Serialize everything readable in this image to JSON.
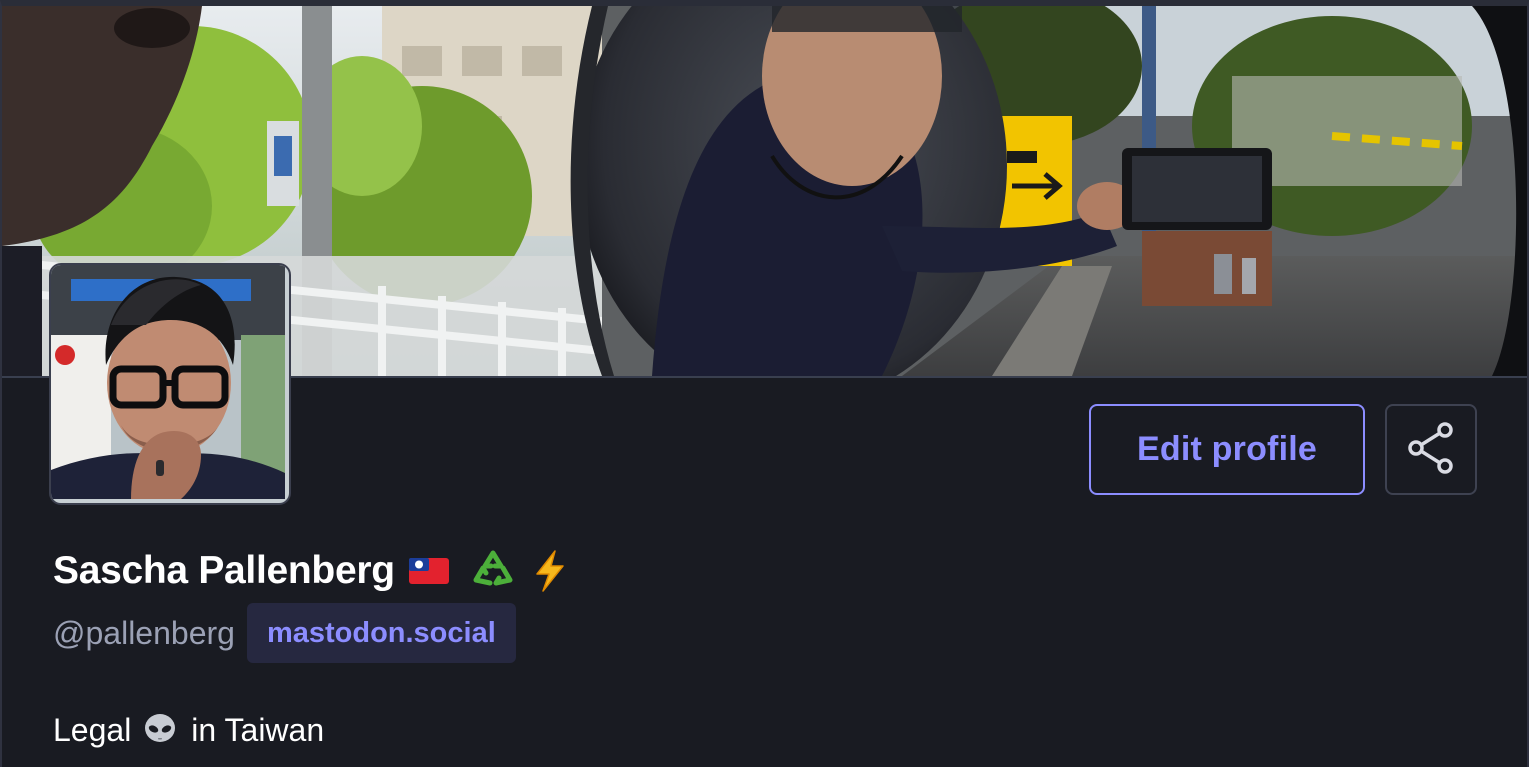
{
  "profile": {
    "display_name": "Sascha Pallenberg",
    "handle": "@pallenberg",
    "server": "mastodon.social",
    "bio_prefix": "Legal",
    "bio_suffix": "in Taiwan",
    "name_emojis": [
      "taiwan-flag-icon",
      "recycling-icon",
      "lightning-icon"
    ],
    "bio_emoji": "alien-icon"
  },
  "actions": {
    "edit_profile_label": "Edit profile",
    "share_icon": "share-icon"
  },
  "colors": {
    "background": "#191b22",
    "accent": "#8c8dff",
    "handle_text": "#9ba1b5",
    "badge_background": "#262840"
  }
}
